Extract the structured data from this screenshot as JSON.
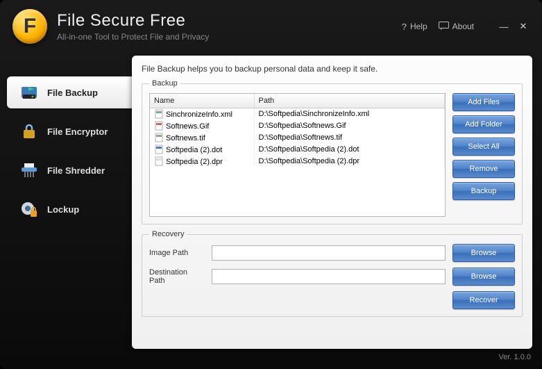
{
  "header": {
    "logo_letter": "F",
    "title": "File Secure Free",
    "subtitle": "All-in-one Tool to Protect File and Privacy",
    "help_label": "Help",
    "about_label": "About"
  },
  "sidebar": {
    "items": [
      {
        "label": "File Backup",
        "icon": "backup"
      },
      {
        "label": "File Encryptor",
        "icon": "encryptor"
      },
      {
        "label": "File Shredder",
        "icon": "shredder"
      },
      {
        "label": "Lockup",
        "icon": "lockup"
      }
    ]
  },
  "main": {
    "help_text": "File Backup helps you to backup personal data and keep it safe.",
    "backup": {
      "legend": "Backup",
      "columns": {
        "name": "Name",
        "path": "Path"
      },
      "rows": [
        {
          "icon": "xml",
          "name": "SinchronizeInfo.xml",
          "path": "D:\\Softpedia\\SinchronizeInfo.xml"
        },
        {
          "icon": "gif",
          "name": "Softnews.Gif",
          "path": "D:\\Softpedia\\Softnews.Gif"
        },
        {
          "icon": "tif",
          "name": "Softnews.tif",
          "path": "D:\\Softpedia\\Softnews.tif"
        },
        {
          "icon": "doc",
          "name": "Softpedia (2).dot",
          "path": "D:\\Softpedia\\Softpedia (2).dot"
        },
        {
          "icon": "file",
          "name": "Softpedia (2).dpr",
          "path": "D:\\Softpedia\\Softpedia (2).dpr"
        }
      ],
      "buttons": {
        "add_files": "Add Files",
        "add_folder": "Add Folder",
        "select_all": "Select All",
        "remove": "Remove",
        "backup": "Backup"
      }
    },
    "recovery": {
      "legend": "Recovery",
      "image_path_label": "Image Path",
      "destination_label": "Destination Path",
      "image_path_value": "",
      "destination_value": "",
      "browse_label": "Browse",
      "recover_label": "Recover"
    }
  },
  "footer": {
    "version": "Ver. 1.0.0"
  }
}
